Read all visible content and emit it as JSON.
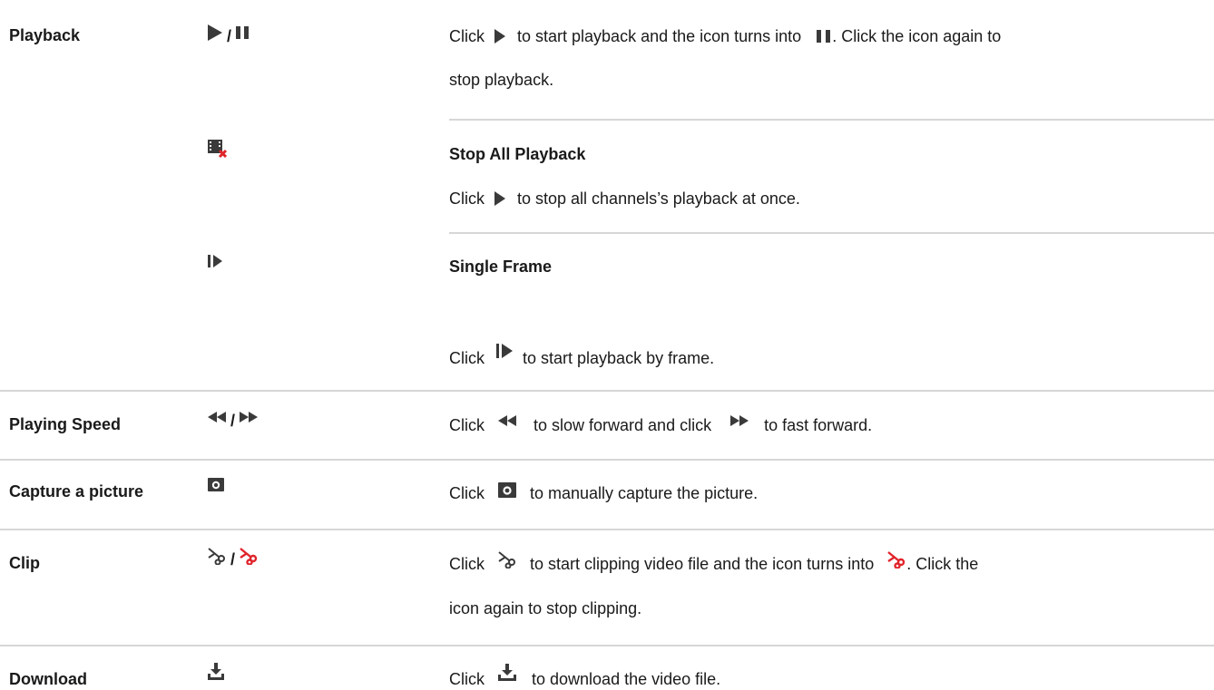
{
  "rows": {
    "playback": {
      "label": "Playback",
      "sep": "/",
      "d1": "Click",
      "d2": "to start playback and the icon turns into",
      "d3": ". Click the icon again to",
      "d4": "stop playback."
    },
    "stop_all": {
      "title": "Stop All Playback",
      "d1": "Click",
      "d2": "to stop all channels’s playback at once."
    },
    "single_frame": {
      "title": "Single Frame",
      "d1": "Click",
      "d2": "to start playback by frame."
    },
    "speed": {
      "label": "Playing Speed",
      "sep": "/",
      "d1": "Click",
      "d2": "to slow forward and click",
      "d3": "to fast forward."
    },
    "capture": {
      "label": "Capture a picture",
      "d1": "Click",
      "d2": "to manually capture the picture."
    },
    "clip": {
      "label": "Clip",
      "sep": "/",
      "d1": "Click",
      "d2": "to start clipping video file and the icon turns into",
      "d3": ". Click the",
      "d4": "icon again to stop clipping."
    },
    "download": {
      "label": "Download",
      "d1": "Click",
      "d2": "to download the video file."
    }
  },
  "icons": {
    "play": "play-icon",
    "pause": "pause-icon",
    "stop_all": "stop-all-playback-icon",
    "single_frame": "single-frame-icon",
    "slow": "slow-forward-icon",
    "fast": "fast-forward-icon",
    "capture": "camera-icon",
    "clip": "scissors-icon",
    "clip_active": "scissors-active-icon",
    "download": "download-icon"
  },
  "colors": {
    "icon": "#3a3a3a",
    "clip_active": "#e0242b",
    "stop_badge": "#e0242b",
    "divider": "#d6d6d6"
  }
}
